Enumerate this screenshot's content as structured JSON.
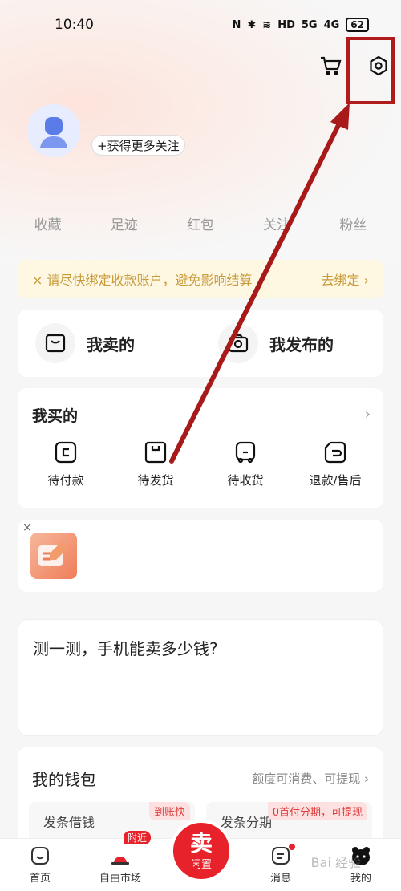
{
  "status": {
    "time": "10:40",
    "signal1": "5G",
    "signal2": "4G",
    "battery": "62",
    "hd": "HD"
  },
  "header": {
    "cart_icon": "cart-icon",
    "settings_icon": "settings-icon"
  },
  "profile": {
    "follow_button": "+获得更多关注"
  },
  "stats": [
    "收藏",
    "足迹",
    "红包",
    "关注",
    "粉丝"
  ],
  "notice": {
    "icon": "×",
    "text": "请尽快绑定收款账户，避免影响结算",
    "action": "去绑定",
    "chevron": "›"
  },
  "sell": {
    "sold_label": "我卖的",
    "published_label": "我发布的"
  },
  "bought": {
    "title": "我买的",
    "chevron": "›",
    "items": [
      "待付款",
      "待发货",
      "待收货",
      "退款/售后"
    ]
  },
  "promo": {
    "close": "×"
  },
  "quiz": {
    "title": "测一测，手机能卖多少钱?"
  },
  "wallet": {
    "title": "我的钱包",
    "subtitle": "额度可消费、可提现",
    "chevron": "›",
    "items": [
      {
        "label": "发条借钱",
        "badge": "到账快"
      },
      {
        "label": "发条分期",
        "badge": "0首付分期，可提现"
      }
    ]
  },
  "tabbar": {
    "home": "首页",
    "market": "自由市场",
    "market_badge": "附近",
    "center_big": "卖",
    "center_small": "闲置",
    "messages": "消息",
    "mine": "我的"
  },
  "watermark": "Bai 经验",
  "colors": {
    "accent": "#e8222a",
    "highlight": "#b01c1c",
    "notice_bg": "#fef7e2"
  }
}
